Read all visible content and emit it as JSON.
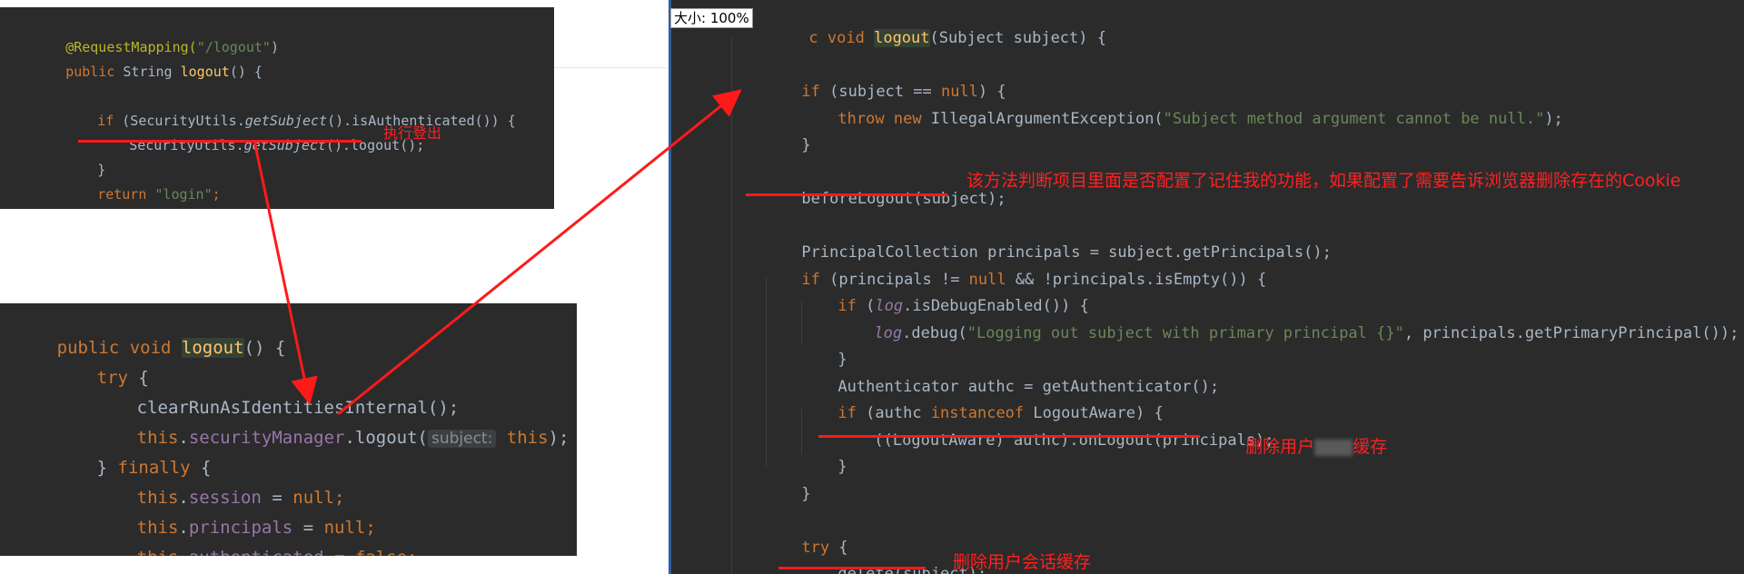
{
  "zoom_label": "大小: 100%",
  "panel1": {
    "lines": [
      [
        "@RequestMapping(",
        "\"/logout\"",
        ")"
      ],
      [
        "public ",
        "String ",
        "logout",
        "() {"
      ],
      [
        "if ",
        "(SecurityUtils.",
        "getSubject",
        "().isAuthenticated()) {"
      ],
      [
        "SecurityUtils.",
        "getSubject",
        "().logout();"
      ],
      [
        "}"
      ],
      [
        "return ",
        "\"login\"",
        ";"
      ],
      [
        "}"
      ]
    ],
    "note": "执行登出"
  },
  "panel2": {
    "lines": [
      [
        "public ",
        "void ",
        "logout",
        "() {"
      ],
      [
        "try ",
        "{"
      ],
      [
        "clearRunAsIdentitiesInternal();"
      ],
      [
        "this",
        ".",
        "securityManager",
        ".logout(",
        "subject:",
        " this",
        ");"
      ],
      [
        "} ",
        "finally ",
        "{"
      ],
      [
        "this",
        ".",
        "session",
        " = ",
        "null",
        ";"
      ],
      [
        "this",
        ".",
        "principals",
        " = ",
        "null",
        ";"
      ],
      [
        "this",
        ".",
        "authenticated",
        " = ",
        "false",
        ";"
      ]
    ]
  },
  "panel3": {
    "header": [
      "c ",
      "void ",
      "logout",
      "(Subject subject) {"
    ],
    "lines": [
      [
        "if ",
        "(subject == ",
        "null",
        ") {"
      ],
      [
        "throw ",
        "new ",
        "IllegalArgumentException(",
        "\"Subject method argument cannot be null.\"",
        ");"
      ],
      [
        "}"
      ],
      [
        "beforeLogout(subject);"
      ],
      [
        "PrincipalCollection principals = subject.getPrincipals();"
      ],
      [
        "if ",
        "(principals != ",
        "null ",
        "&& !principals.isEmpty()) {"
      ],
      [
        "if ",
        "(",
        "log",
        ".isDebugEnabled()) {"
      ],
      [
        "log",
        ".debug(",
        "\"Logging out subject with primary principal {}\"",
        ", principals.getPrimaryPrincipal());"
      ],
      [
        "}"
      ],
      [
        "Authenticator authc = getAuthenticator();"
      ],
      [
        "if ",
        "(authc ",
        "instanceof ",
        "LogoutAware) {"
      ],
      [
        "((LogoutAware) authc).onLogout(principals);"
      ],
      [
        "}"
      ],
      [
        "}"
      ],
      [
        "try ",
        "{"
      ],
      [
        "delete(subject);"
      ]
    ],
    "notes": {
      "before_logout": "该方法判断项目里面是否配置了记住我的功能，如果配置了需要告诉浏览器删除存在的Cookie",
      "on_logout_prefix": "删除用户",
      "on_logout_suffix": "缓存",
      "delete": "删除用户会话缓存"
    }
  },
  "colors": {
    "editor_bg": "#2b2b2b",
    "keyword": "#cc7832",
    "method": "#ffc66d",
    "field": "#9876aa",
    "string": "#6a8759",
    "text": "#a9b7c6",
    "annotation_red": "#ff1a1a"
  }
}
